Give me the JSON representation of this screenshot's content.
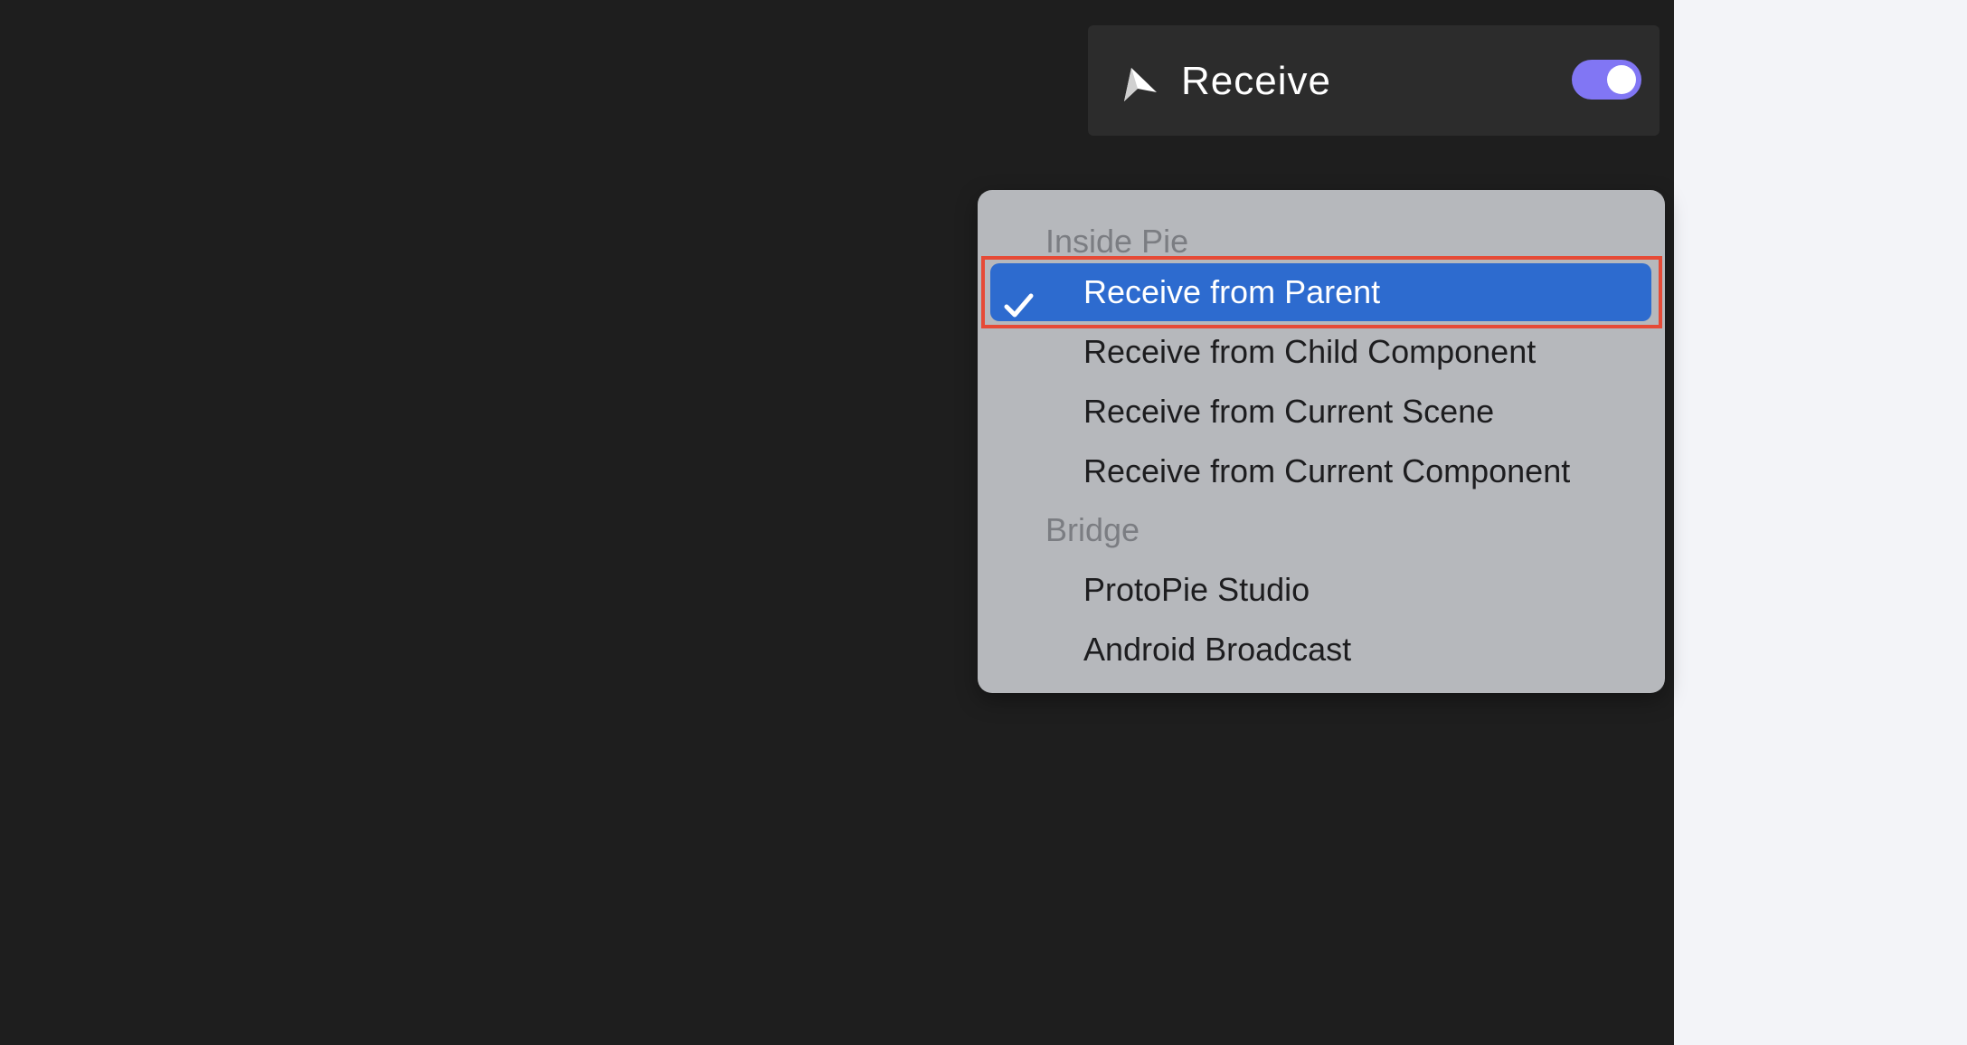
{
  "header": {
    "icon": "send-arrow-icon",
    "title": "Receive",
    "toggle_on": true,
    "toggle_color": "#8176f4"
  },
  "menu": {
    "sections": [
      {
        "label": "Inside Pie",
        "items": [
          {
            "label": "Receive from Parent",
            "selected": true
          },
          {
            "label": "Receive from Child Component",
            "selected": false
          },
          {
            "label": "Receive from Current Scene",
            "selected": false
          },
          {
            "label": "Receive from Current Component",
            "selected": false
          }
        ]
      },
      {
        "label": "Bridge",
        "items": [
          {
            "label": "ProtoPie Studio",
            "selected": false
          },
          {
            "label": "Android Broadcast",
            "selected": false
          }
        ]
      }
    ],
    "selected_color": "#2d6bcf",
    "highlight_color": "#e64a36"
  }
}
